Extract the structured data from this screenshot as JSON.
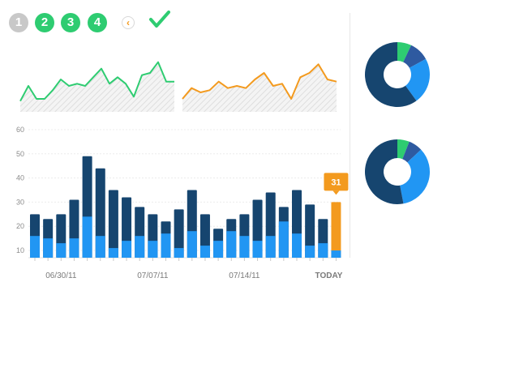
{
  "steps": [
    {
      "label": "1",
      "state": "done"
    },
    {
      "label": "2",
      "state": "active"
    },
    {
      "label": "3",
      "state": "active"
    },
    {
      "label": "4",
      "state": "active"
    }
  ],
  "icons": {
    "back": "chevron-left-icon",
    "complete": "checkmark-icon"
  },
  "colors": {
    "green": "#2ecc71",
    "orange": "#f39a1e",
    "dark_blue": "#16456f",
    "light_blue": "#2196f3",
    "mid_blue": "#2e5aa0",
    "step_done": "#c8c8c8"
  },
  "chart_data": [
    {
      "type": "area",
      "series": [
        {
          "values": [
            5,
            12,
            6,
            6,
            10,
            15,
            12,
            13,
            12,
            16,
            20,
            13,
            16,
            13,
            7,
            17,
            18,
            23,
            14,
            14
          ]
        }
      ],
      "ylim": [
        0,
        30
      ],
      "color": "#2ecc71",
      "fill": "hatched grey"
    },
    {
      "type": "area",
      "series": [
        {
          "values": [
            6,
            11,
            9,
            10,
            14,
            11,
            12,
            11,
            15,
            18,
            12,
            13,
            6,
            16,
            18,
            22,
            15,
            14
          ]
        }
      ],
      "ylim": [
        0,
        30
      ],
      "color": "#f39a1e",
      "fill": "hatched grey"
    },
    {
      "type": "bar",
      "stacked": true,
      "yticks": [
        "10",
        "20",
        "30",
        "40",
        "50",
        "60"
      ],
      "ylim": [
        7,
        60
      ],
      "xlabels": [
        "06/30/11",
        "07/07/11",
        "07/14/11",
        "TODAY"
      ],
      "xlabel_positions": [
        2,
        9,
        16,
        23
      ],
      "series": [
        {
          "values": [
            16,
            15,
            13,
            15,
            24,
            16,
            11,
            14,
            16,
            14,
            17,
            11,
            18,
            12,
            14,
            18,
            16,
            14,
            16,
            22,
            17,
            12,
            13,
            10
          ]
        },
        {
          "values": [
            25,
            23,
            25,
            31,
            49,
            44,
            35,
            32,
            28,
            25,
            22,
            27,
            35,
            25,
            19,
            23,
            25,
            31,
            34,
            28,
            35,
            29,
            23,
            30
          ]
        }
      ],
      "highlight": {
        "index": 23,
        "label": "31",
        "color": "#f39a1e"
      },
      "grid": true
    },
    {
      "type": "pie",
      "donut": true,
      "slices": [
        {
          "value": 7,
          "color": "#2ecc71"
        },
        {
          "value": 10,
          "color": "#2e5aa0"
        },
        {
          "value": 23,
          "color": "#2196f3"
        },
        {
          "value": 60,
          "color": "#16456f"
        }
      ]
    },
    {
      "type": "pie",
      "donut": true,
      "slices": [
        {
          "value": 6,
          "color": "#2ecc71"
        },
        {
          "value": 7,
          "color": "#2e5aa0"
        },
        {
          "value": 34,
          "color": "#2196f3"
        },
        {
          "value": 53,
          "color": "#16456f"
        }
      ]
    }
  ]
}
